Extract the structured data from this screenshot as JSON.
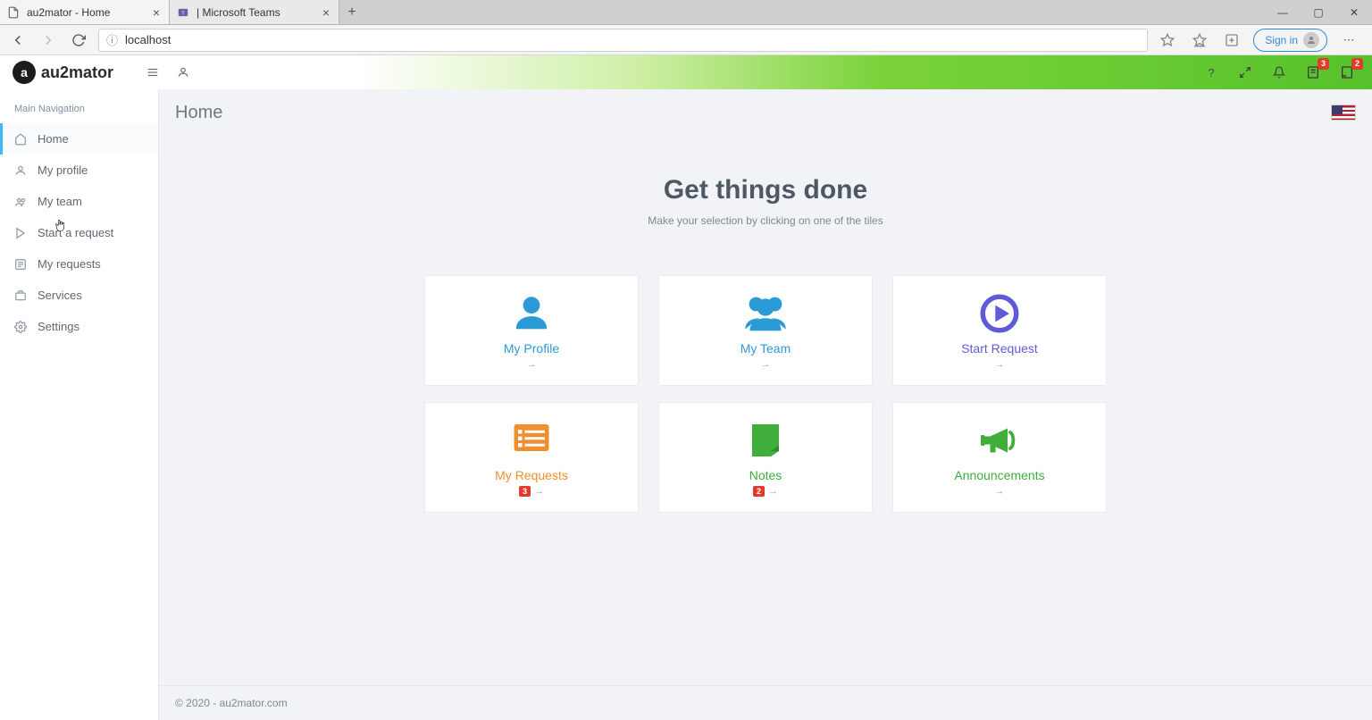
{
  "browser": {
    "tabs": [
      {
        "title": "au2mator - Home"
      },
      {
        "title": "| Microsoft Teams"
      }
    ],
    "url": "localhost",
    "signin_label": "Sign in"
  },
  "header": {
    "logo_text": "au2mator",
    "icons": {
      "help": "?",
      "fullscreen": "⤢",
      "bell": "🔔",
      "doc_badge": "3",
      "note_badge": "2"
    }
  },
  "sidebar": {
    "heading": "Main Navigation",
    "items": [
      {
        "label": "Home"
      },
      {
        "label": "My profile"
      },
      {
        "label": "My team"
      },
      {
        "label": "Start a request"
      },
      {
        "label": "My requests"
      },
      {
        "label": "Services"
      },
      {
        "label": "Settings"
      }
    ]
  },
  "page": {
    "title": "Home",
    "hero_title": "Get things done",
    "hero_sub": "Make your selection by clicking on one of the tiles"
  },
  "tiles": [
    {
      "title": "My Profile",
      "arrow": "→",
      "colorClass": "blue",
      "count": ""
    },
    {
      "title": "My Team",
      "arrow": "→",
      "colorClass": "blue",
      "count": ""
    },
    {
      "title": "Start Request",
      "arrow": "→",
      "colorClass": "purple",
      "count": ""
    },
    {
      "title": "My Requests",
      "arrow": "→",
      "colorClass": "orange",
      "count": "3"
    },
    {
      "title": "Notes",
      "arrow": "→",
      "colorClass": "green",
      "count": "2"
    },
    {
      "title": "Announcements",
      "arrow": "→",
      "colorClass": "green",
      "count": ""
    }
  ],
  "footer": "© 2020 - au2mator.com"
}
